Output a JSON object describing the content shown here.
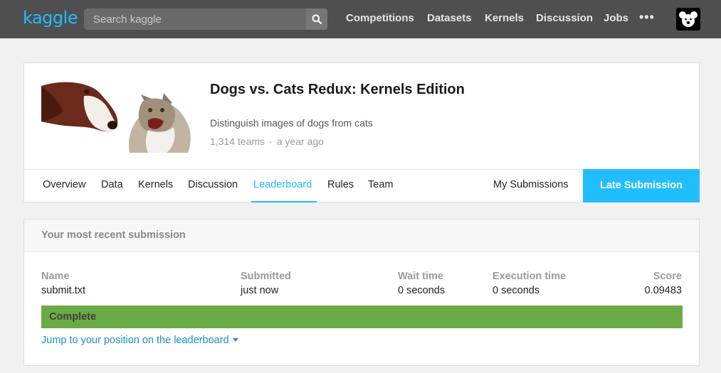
{
  "nav": {
    "logo": "kaggle",
    "search_placeholder": "Search kaggle",
    "links": [
      "Competitions",
      "Datasets",
      "Kernels",
      "Discussion",
      "Jobs"
    ],
    "more": "•••"
  },
  "competition": {
    "title": "Dogs vs. Cats Redux: Kernels Edition",
    "description": "Distinguish images of dogs from cats",
    "teams": "1,314 teams",
    "separator": "·",
    "age": "a year ago",
    "tabs": [
      "Overview",
      "Data",
      "Kernels",
      "Discussion",
      "Leaderboard",
      "Rules",
      "Team"
    ],
    "active_tab": "Leaderboard",
    "my_submissions": "My Submissions",
    "late_submission": "Late Submission"
  },
  "submission": {
    "header": "Your most recent submission",
    "columns": {
      "name": "Name",
      "submitted": "Submitted",
      "wait_time": "Wait time",
      "execution_time": "Execution time",
      "score": "Score"
    },
    "values": {
      "name": "submit.txt",
      "submitted": "just now",
      "wait_time": "0 seconds",
      "execution_time": "0 seconds",
      "score": "0.09483"
    },
    "status": "Complete",
    "jump_link": "Jump to your position on the leaderboard"
  },
  "colors": {
    "accent": "#20beff",
    "nav_bg": "#4f4f4f",
    "complete_green": "#6aab46"
  }
}
